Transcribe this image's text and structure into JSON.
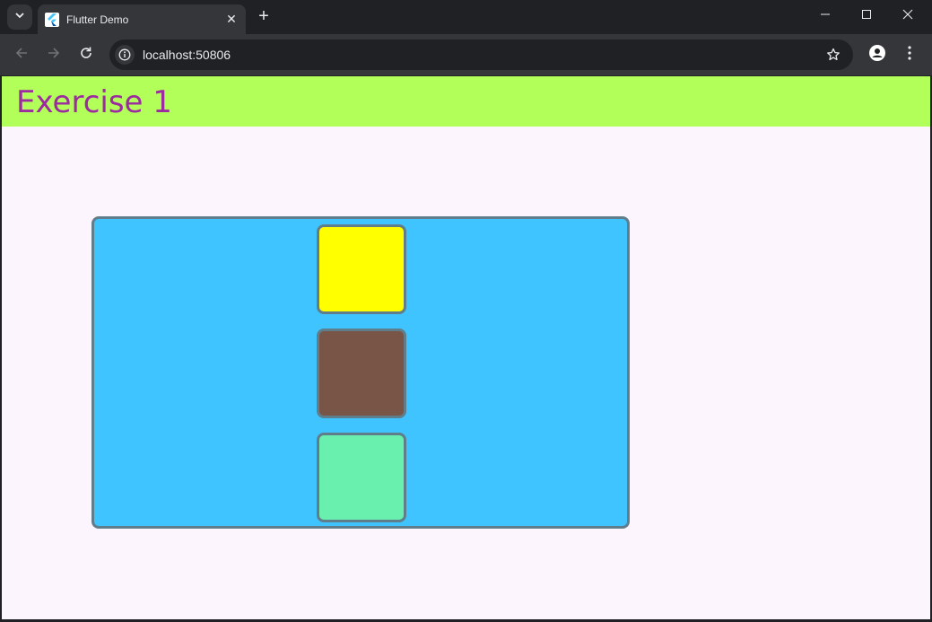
{
  "browser": {
    "tab": {
      "title": "Flutter Demo",
      "close": "✕"
    },
    "new_tab": "+",
    "omnibox": {
      "url": "localhost:50806"
    }
  },
  "app": {
    "appbar": {
      "title": "Exercise 1"
    },
    "colors": {
      "appbar_background": "#b2ff59",
      "title_text": "#9c2aa0",
      "page_background": "#fdf5fd",
      "container_background": "#40c4ff",
      "border": "#607d8b",
      "box_1": "#ffff00",
      "box_2": "#795548",
      "box_3": "#69f0ae"
    },
    "boxes": [
      {
        "color": "#ffff00"
      },
      {
        "color": "#795548"
      },
      {
        "color": "#69f0ae"
      }
    ]
  }
}
